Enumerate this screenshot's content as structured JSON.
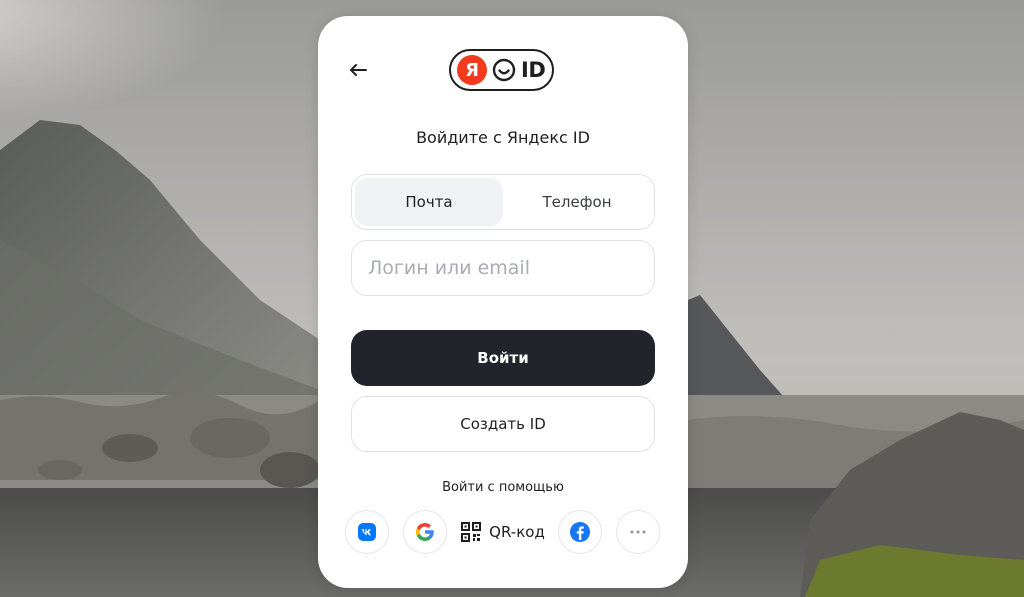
{
  "auth": {
    "logo": {
      "letter": "Я",
      "text": "ID"
    },
    "heading": "Войдите с Яндекс ID",
    "tabs": [
      {
        "label": "Почта",
        "active": true
      },
      {
        "label": "Телефон",
        "active": false
      }
    ],
    "login_input": {
      "value": "",
      "placeholder": "Логин или email"
    },
    "primary_button": "Войти",
    "create_button": "Создать ID",
    "social_label": "Войти с помощью",
    "social": {
      "vk_icon": "vk-icon",
      "google_icon": "google-icon",
      "qr_label": "QR-код",
      "facebook_icon": "facebook-icon",
      "more_icon": "more-icon"
    }
  },
  "colors": {
    "primary_button": "#23232b",
    "logo_red": "#f23a1d",
    "vk_blue": "#0077ff",
    "facebook_blue": "#1877f2"
  }
}
